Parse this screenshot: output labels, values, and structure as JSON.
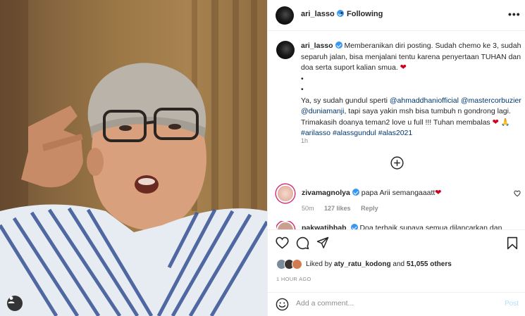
{
  "post": {
    "username": "ari_lasso",
    "follow_status": "Following",
    "separator": "•",
    "more_label": "•••"
  },
  "caption": {
    "username": "ari_lasso",
    "line_1": "Memberanikan diri posting. Sudah chemo ke 3, sudah separuh jalan, bisa menjalani tentu karena penyertaan TUHAN dan doa serta suport kalian smua.",
    "heart": "❤",
    "bullet_1": "•",
    "bullet_2": "•",
    "line_2_start": "Ya, sy sudah gundul sperti",
    "mention_1": "@ahmaddhaniofficial",
    "mention_2": "@mastercorbuzier",
    "mention_3": "@duniamanji",
    "line_2_end": ", tapi saya yakin msh bisa tumbuh n gondrong lagi. Trimakasih doanya teman2 love u full !!! Tuhan membalas",
    "heart_2": "❤",
    "pray": "🙏",
    "hashtag_1": "#arilasso",
    "hashtag_2": "#alassgundul",
    "hashtag_3": "#alas2021",
    "time": "1h"
  },
  "comments": [
    {
      "username": "zivamagnolya",
      "text": "papa Arii semangaaatt",
      "emoji": "❤",
      "time": "50m",
      "likes": "127 likes",
      "reply": "Reply"
    },
    {
      "username": "pakwatihbab",
      "text": "Doa terbaik supaya semua dilancarkan dan"
    }
  ],
  "likes": {
    "prefix": "Liked by",
    "user": "aty_ratu_kodong",
    "conjunction": "and",
    "count": "51,055 others"
  },
  "posted_ago": "1 HOUR AGO",
  "add_comment": {
    "placeholder": "Add a comment...",
    "post_label": "Post"
  },
  "colors": {
    "verified": "#3897f0",
    "link": "#00376b",
    "heart": "#d0021b",
    "post_disabled": "#b2dffc"
  }
}
